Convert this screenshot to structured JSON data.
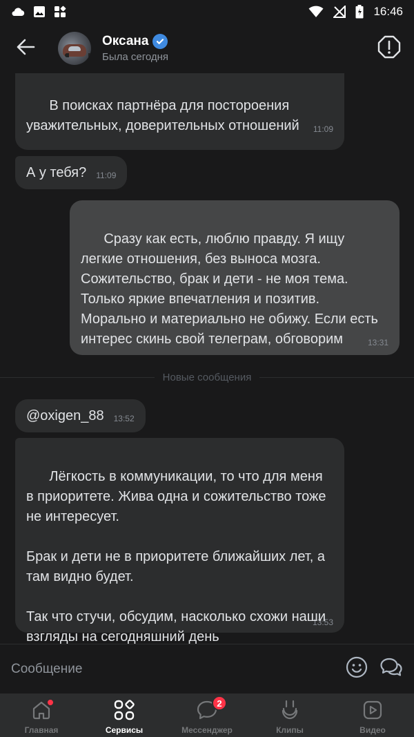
{
  "status_bar": {
    "time": "16:46",
    "left_icons": [
      "cloud-icon",
      "image-icon",
      "apps-icon"
    ],
    "right_icons": [
      "wifi-icon",
      "no-signal-icon",
      "battery-icon"
    ]
  },
  "header": {
    "name": "Оксана",
    "verified": true,
    "status": "Была сегодня",
    "back_icon": "arrow-left-icon",
    "report_icon": "warning-octagon-icon"
  },
  "messages": [
    {
      "direction": "in",
      "text": "В поисках партнёра для постороения уважительных, доверительных отношений",
      "time": "11:09"
    },
    {
      "direction": "in",
      "text": "А у тебя?",
      "time": "11:09"
    },
    {
      "direction": "out",
      "text": "Сразу как есть, люблю правду. Я ищу легкие отношения, без выноса мозга. Сожительство, брак и дети - не моя тема. Только яркие впечатления и позитив. Морально и материально не обижу. Если есть интерес скинь свой телеграм, обговорим",
      "time": "13:31"
    },
    {
      "direction": "in",
      "text": "@oxigen_88",
      "time": "13:52"
    },
    {
      "direction": "in",
      "text": "Лёгкость в коммуникации, то что для меня в приоритете. Жива одна и сожительство тоже не интересует.\n\nБрак и дети не в приоритете ближайших лет, а там видно будет.\n\nТак что стучи, обсудим, насколько схожи наши взгляды на сегодняшний день",
      "time": "13:53"
    }
  ],
  "divider": {
    "label": "Новые сообщения"
  },
  "compose": {
    "placeholder": "Сообщение",
    "value": "",
    "emoji_icon": "smiley-icon",
    "extra_icon": "chat-bubbles-icon"
  },
  "tabbar": {
    "tabs": [
      {
        "label": "Главная",
        "icon": "home-icon",
        "active": false,
        "dot": true
      },
      {
        "label": "Сервисы",
        "icon": "services-grid-icon",
        "active": true
      },
      {
        "label": "Мессенджер",
        "icon": "message-icon",
        "active": false,
        "badge": "2"
      },
      {
        "label": "Клипы",
        "icon": "clips-icon",
        "active": false
      },
      {
        "label": "Видео",
        "icon": "video-icon",
        "active": false
      }
    ]
  },
  "colors": {
    "background": "#19191a",
    "bubble_in": "#2c2d2e",
    "bubble_out": "#454647",
    "accent": "#3f8ae0",
    "badge": "#ff3347"
  }
}
